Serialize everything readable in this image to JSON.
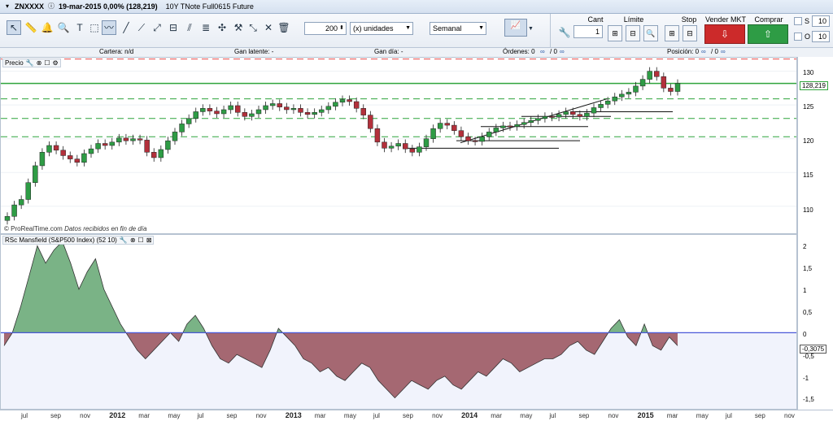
{
  "window": {
    "symbol": "ZNXXXX",
    "date_info": "19-mar-2015  0,00% (128,219)",
    "instrument": "10Y TNote Full0615 Future"
  },
  "toolbar": {
    "units_value": "200",
    "units_label": "(x) unidades",
    "period": "Semanal"
  },
  "order_panel": {
    "cant_label": "Cant",
    "cant_value": "1",
    "limit_label": "Límite",
    "stop_label": "Stop",
    "sell_label": "Vender MKT",
    "buy_label": "Comprar MKT",
    "s_label": "S",
    "s_value": "10",
    "o_label": "O",
    "o_value": "10"
  },
  "infobar": {
    "cartera": "Cartera:  n/d",
    "gan_latente": "Gan latente:  -",
    "gan_dia": "Gan día:  -",
    "ordenes": "Órdenes:  0",
    "ordenes_sep": "/  0",
    "posicion": "Posición:  0",
    "posicion_sep": "/  0"
  },
  "price_pane": {
    "title": "Precio",
    "last_price": "128,219",
    "credit_brand": "© ProRealTime.com",
    "credit_note": "Datos recibidos en fin de día",
    "yticks": [
      "130",
      "125",
      "120",
      "115",
      "110"
    ]
  },
  "indicator_pane": {
    "title": "RSc Mansfield (S&P500 Index) (52 10)",
    "last_value": "-0,3075",
    "yticks": [
      "2",
      "1,5",
      "1",
      "0,5",
      "0",
      "-0,5",
      "-1",
      "-1,5"
    ]
  },
  "xaxis": {
    "labels": [
      "jul",
      "sep",
      "nov",
      "2012",
      "mar",
      "may",
      "jul",
      "sep",
      "nov",
      "2013",
      "mar",
      "may",
      "jul",
      "sep",
      "nov",
      "2014",
      "mar",
      "may",
      "jul",
      "sep",
      "nov",
      "2015",
      "mar",
      "may",
      "jul",
      "sep",
      "nov"
    ]
  },
  "colors": {
    "bull": "#2e9c45",
    "bear": "#b3303b",
    "level_green": "#2fa43c",
    "level_red": "#e24848",
    "zero_line": "#4a58d8",
    "area_pos": "#4e9a5e",
    "area_neg": "#8b3a44"
  },
  "chart_data": {
    "type": "candlestick",
    "timeframe": "weekly",
    "x_start": "2011-06",
    "price": [
      108.5,
      110.2,
      111.0,
      113.5,
      116.0,
      118.0,
      119.0,
      118.3,
      117.5,
      117.0,
      116.5,
      117.8,
      118.5,
      119.3,
      119.0,
      119.5,
      120.1,
      119.7,
      120.0,
      119.8,
      118.0,
      117.2,
      118.4,
      119.7,
      121.0,
      122.2,
      123.0,
      124.0,
      124.5,
      124.1,
      123.7,
      124.3,
      124.9,
      123.9,
      123.3,
      123.7,
      124.3,
      124.9,
      125.2,
      124.7,
      124.3,
      124.5,
      123.9,
      123.6,
      123.9,
      124.3,
      124.8,
      125.4,
      125.8,
      125.5,
      124.5,
      123.5,
      121.5,
      119.5,
      118.6,
      118.9,
      119.3,
      118.5,
      118.0,
      118.8,
      120.0,
      121.5,
      122.3,
      122.0,
      121.2,
      120.3,
      119.7,
      119.6,
      120.3,
      121.0,
      121.6,
      121.9,
      121.8,
      122.1,
      122.4,
      122.7,
      123.0,
      123.3,
      123.2,
      123.6,
      124.0,
      123.6,
      123.3,
      123.8,
      124.6,
      125.1,
      125.6,
      126.2,
      126.6,
      126.9,
      127.8,
      128.8,
      130.0,
      129.2,
      127.5,
      127.0,
      128.2
    ],
    "rsc_mansfield": [
      -0.3,
      0.0,
      0.6,
      1.3,
      2.0,
      1.6,
      1.9,
      2.1,
      1.6,
      1.0,
      1.4,
      1.7,
      1.0,
      0.6,
      0.2,
      -0.1,
      -0.4,
      -0.6,
      -0.4,
      -0.2,
      0.0,
      -0.2,
      0.2,
      0.4,
      0.1,
      -0.3,
      -0.6,
      -0.7,
      -0.5,
      -0.6,
      -0.7,
      -0.8,
      -0.4,
      0.1,
      -0.1,
      -0.3,
      -0.6,
      -0.7,
      -0.9,
      -0.8,
      -1.0,
      -1.1,
      -0.9,
      -0.7,
      -0.8,
      -1.1,
      -1.3,
      -1.5,
      -1.3,
      -1.1,
      -1.2,
      -1.3,
      -1.1,
      -1.0,
      -1.2,
      -1.3,
      -1.1,
      -0.9,
      -1.0,
      -0.8,
      -0.6,
      -0.7,
      -0.9,
      -0.8,
      -0.7,
      -0.6,
      -0.6,
      -0.5,
      -0.3,
      -0.2,
      -0.4,
      -0.5,
      -0.2,
      0.1,
      0.3,
      -0.1,
      -0.3,
      0.2,
      -0.3,
      -0.4,
      -0.1,
      -0.3
    ],
    "price_ylim": [
      106,
      132
    ],
    "rsc_ylim": [
      -1.75,
      2.25
    ],
    "horizontal_levels": [
      {
        "value": 131.8,
        "style": "dashed",
        "color": "red"
      },
      {
        "value": 128.2,
        "style": "solid",
        "color": "green"
      },
      {
        "value": 125.9,
        "style": "dashed",
        "color": "green"
      },
      {
        "value": 123.0,
        "style": "dashed",
        "color": "green"
      },
      {
        "value": 120.3,
        "style": "dashed",
        "color": "green"
      }
    ],
    "zero_line": 0
  }
}
